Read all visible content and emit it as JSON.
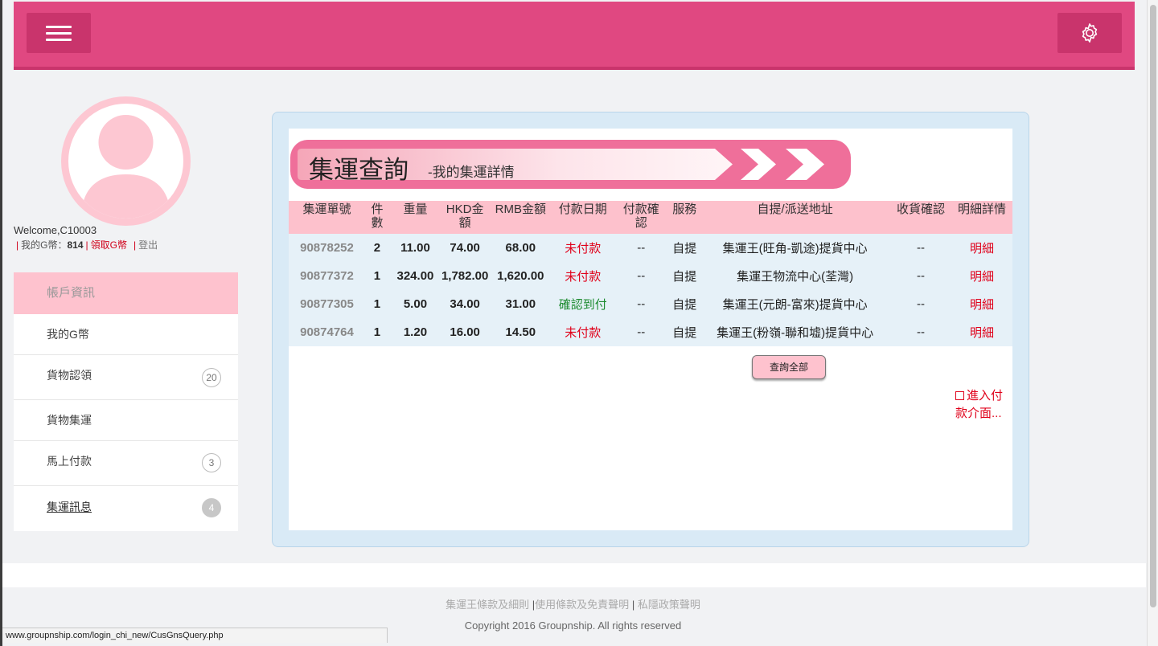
{
  "header": {
    "menu_icon": "hamburger-icon",
    "settings_icon": "gear-icon",
    "brand_color": "#e04881"
  },
  "sidebar": {
    "welcome": "Welcome,C10003",
    "g_coin_label": "我的G幣：",
    "g_coin_amount": "814",
    "claim_label": "領取G幣",
    "logout_label": "登出",
    "section_title": "帳戶資訊",
    "items": [
      {
        "label": "我的G幣",
        "badge": ""
      },
      {
        "label": "貨物認領",
        "badge": "20"
      },
      {
        "label": "貨物集運",
        "badge": ""
      },
      {
        "label": "馬上付款",
        "badge": "3"
      },
      {
        "label": "集運訊息",
        "badge": "4"
      }
    ]
  },
  "main": {
    "banner_title": "集運查詢",
    "banner_subtitle": "-我的集運詳情",
    "columns": [
      "集運單號",
      "件數",
      "重量",
      "HKD金額",
      "RMB金額",
      "付款日期",
      "付款確認",
      "服務",
      "自提/派送地址",
      "收貨確認",
      "明細詳情"
    ],
    "rows": [
      {
        "no": "90878252",
        "pieces": "2",
        "weight": "11.00",
        "hkd": "74.00",
        "rmb": "68.00",
        "pay_date": "未付款",
        "pay_status": "unpaid",
        "pay_confirm": "--",
        "service": "自提",
        "address": "集運王(旺角-凱途)提貨中心",
        "receive": "--",
        "detail": "明細"
      },
      {
        "no": "90877372",
        "pieces": "1",
        "weight": "324.00",
        "hkd": "1,782.00",
        "rmb": "1,620.00",
        "pay_date": "未付款",
        "pay_status": "unpaid",
        "pay_confirm": "--",
        "service": "自提",
        "address": "集運王物流中心(荃灣)",
        "receive": "--",
        "detail": "明細"
      },
      {
        "no": "90877305",
        "pieces": "1",
        "weight": "5.00",
        "hkd": "34.00",
        "rmb": "31.00",
        "pay_date": "確認到付",
        "pay_status": "confirm",
        "pay_confirm": "--",
        "service": "自提",
        "address": "集運王(元朗-富來)提貨中心",
        "receive": "--",
        "detail": "明細"
      },
      {
        "no": "90874764",
        "pieces": "1",
        "weight": "1.20",
        "hkd": "16.00",
        "rmb": "14.50",
        "pay_date": "未付款",
        "pay_status": "unpaid",
        "pay_confirm": "--",
        "service": "自提",
        "address": "集運王(粉嶺-聯和墟)提貨中心",
        "receive": "--",
        "detail": "明細"
      }
    ],
    "query_all_label": "查詢全部",
    "pay_link_label": "進入付款介面..."
  },
  "footer": {
    "link_terms": "集運王條款及細則",
    "link_usage": "使用條款及免責聲明",
    "link_privacy": "私隱政策聲明",
    "separator": "|",
    "copyright": "Copyright 2016 Groupnship. All rights reserved"
  },
  "status_bar": {
    "url": "www.groupnship.com/login_chi_new/CusGnsQuery.php"
  }
}
